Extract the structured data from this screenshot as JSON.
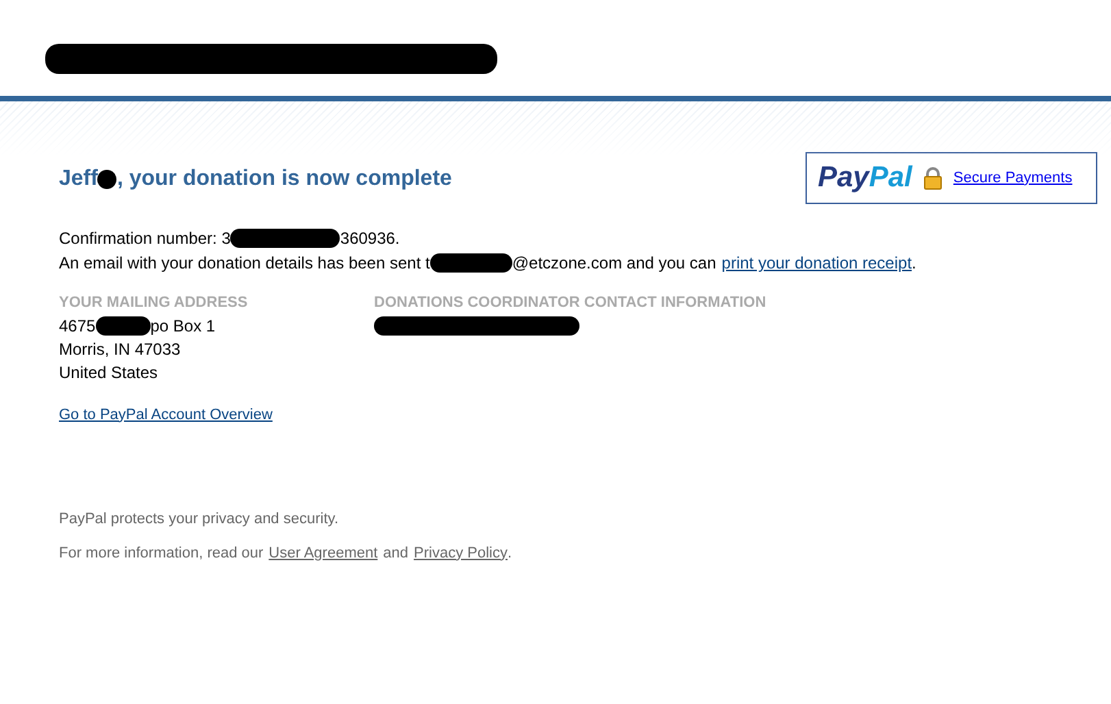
{
  "header": {
    "title": [
      {
        "kind": "redacted"
      }
    ]
  },
  "heading": [
    {
      "kind": "text",
      "text": "Jeff"
    },
    {
      "kind": "redacted"
    },
    {
      "kind": "text",
      "text": ", your donation is now complete"
    }
  ],
  "badge": {
    "logo": "PayPal",
    "link": "Secure Payments"
  },
  "confirmation": [
    {
      "kind": "text",
      "text": "Confirmation number: 3"
    },
    {
      "kind": "redacted"
    },
    {
      "kind": "text",
      "text": "360936."
    }
  ],
  "email_line": [
    {
      "kind": "text",
      "text": "An email with your donation details has been sent t"
    },
    {
      "kind": "redacted"
    },
    {
      "kind": "text",
      "text": "@etczone.com and you can"
    },
    {
      "kind": "link",
      "text": "print your donation receipt"
    },
    {
      "kind": "text",
      "text": "."
    }
  ],
  "mailing_address": {
    "label": "YOUR MAILING ADDRESS",
    "lines": [
      [
        {
          "kind": "text",
          "text": "4675"
        },
        {
          "kind": "redacted"
        },
        {
          "kind": "text",
          "text": "po Box 1"
        }
      ],
      [
        {
          "kind": "text",
          "text": "Morris, IN 47033"
        }
      ],
      [
        {
          "kind": "text",
          "text": "United States"
        }
      ]
    ]
  },
  "coordinator": {
    "label": "DONATIONS COORDINATOR CONTACT INFORMATION",
    "lines": [
      [
        {
          "kind": "redacted"
        }
      ]
    ]
  },
  "account_link": "Go to PayPal Account Overview",
  "footer": {
    "privacy": "PayPal protects your privacy and security.",
    "more": [
      {
        "kind": "text",
        "text": "For more information, read our"
      },
      {
        "kind": "link",
        "text": "User Agreement"
      },
      {
        "kind": "text",
        "text": "and"
      },
      {
        "kind": "link",
        "text": "Privacy Policy"
      },
      {
        "kind": "text",
        "text": "."
      }
    ]
  }
}
